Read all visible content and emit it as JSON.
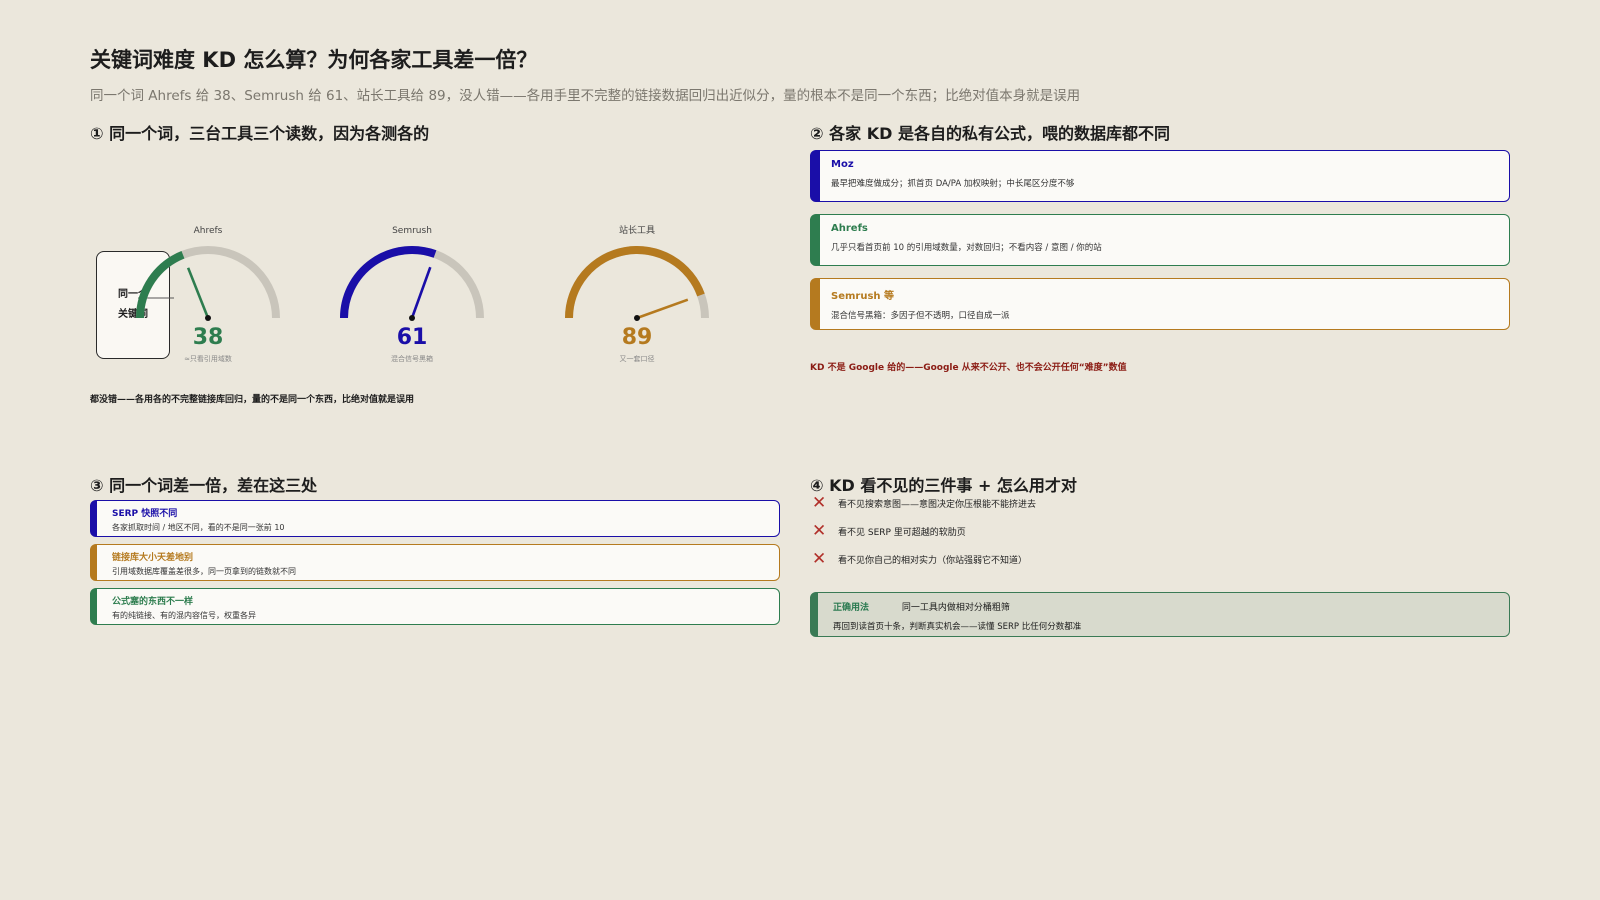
{
  "title": "关键词难度 KD 怎么算？为何各家工具差一倍？",
  "subtitle": "同一个词 Ahrefs 给 38、Semrush 给 61、站长工具给 89，没人错——各用手里不完整的链接数据回归出近似分，量的根本不是同一个东西；比绝对值本身就是误用",
  "section1": {
    "heading": "① 同一个词，三台工具三个读数，因为各测各的",
    "keyword_box": [
      "同一个",
      "关键词"
    ],
    "gauges": [
      {
        "name": "Ahrefs",
        "value": 38,
        "caption": "≈只看引用域数",
        "color": "#2e7d4f"
      },
      {
        "name": "Semrush",
        "value": 61,
        "caption": "混合信号黑箱",
        "color": "#1a0ea8"
      },
      {
        "name": "站长工具",
        "value": 89,
        "caption": "又一套口径",
        "color": "#b57a1f"
      }
    ],
    "gauge_max": 100,
    "track_color": "#c9c5bb",
    "verdict": "都没错——各用各的不完整链接库回归，量的不是同一个东西，比绝对值就是误用"
  },
  "section2": {
    "heading": "② 各家 KD 是各自的私有公式，喂的数据库都不同",
    "cards": [
      {
        "name": "Moz",
        "desc": "最早把难度做成分；抓首页 DA/PA 加权映射；中长尾区分度不够",
        "color": "#1a0ea8"
      },
      {
        "name": "Ahrefs",
        "desc": "几乎只看首页前 10 的引用域数量，对数回归；不看内容 / 意图 / 你的站",
        "color": "#2e7d4f"
      },
      {
        "name": "Semrush 等",
        "desc": "混合信号黑箱：多因子但不透明，口径自成一派",
        "color": "#b57a1f"
      }
    ],
    "note": "KD 不是 Google 给的——Google 从来不公开、也不会公开任何“难度”数值"
  },
  "section3": {
    "heading": "③ 同一个词差一倍，差在这三处",
    "cards": [
      {
        "name": "SERP 快照不同",
        "desc": "各家抓取时间 / 地区不同，看的不是同一张前 10",
        "color": "#1a0ea8"
      },
      {
        "name": "链接库大小天差地别",
        "desc": "引用域数据库覆盖差很多，同一页拿到的链数就不同",
        "color": "#b57a1f"
      },
      {
        "name": "公式塞的东西不一样",
        "desc": "有的纯链接、有的混内容信号，权重各异",
        "color": "#2e7d4f"
      }
    ]
  },
  "section4": {
    "heading": "④ KD 看不见的三件事 + 怎么用才对",
    "blind_spots": [
      "看不见搜索意图——意图决定你压根能不能挤进去",
      "看不见 SERP 里可超越的软肋页",
      "看不见你自己的相对实力（你站强弱它不知道）"
    ],
    "usage_label": "正确用法",
    "usage_line1": "同一工具内做相对分桶粗筛",
    "usage_line2": "再回到读首页十条，判断真实机会——读懂 SERP 比任何分数都准"
  }
}
